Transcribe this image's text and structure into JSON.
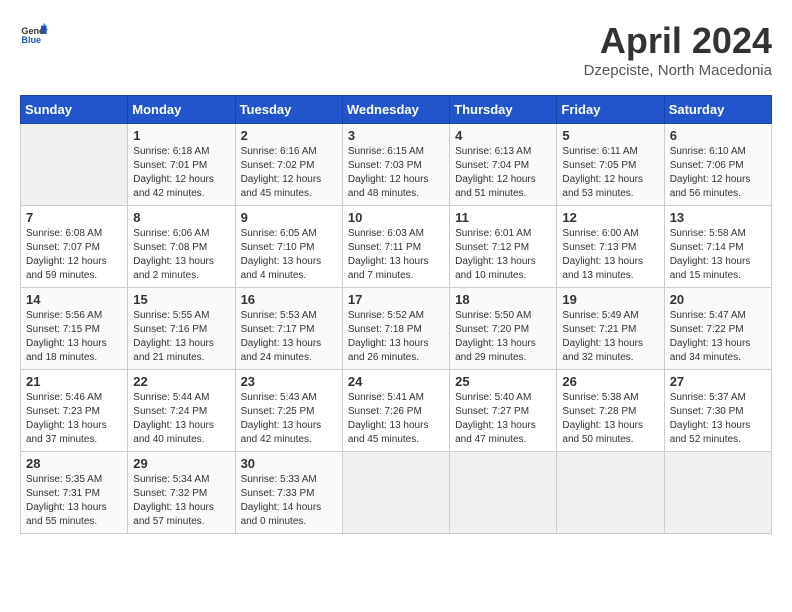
{
  "logo": {
    "line1": "General",
    "line2": "Blue"
  },
  "title": "April 2024",
  "subtitle": "Dzepciste, North Macedonia",
  "days_of_week": [
    "Sunday",
    "Monday",
    "Tuesday",
    "Wednesday",
    "Thursday",
    "Friday",
    "Saturday"
  ],
  "weeks": [
    [
      {
        "day": "",
        "info": ""
      },
      {
        "day": "1",
        "info": "Sunrise: 6:18 AM\nSunset: 7:01 PM\nDaylight: 12 hours\nand 42 minutes."
      },
      {
        "day": "2",
        "info": "Sunrise: 6:16 AM\nSunset: 7:02 PM\nDaylight: 12 hours\nand 45 minutes."
      },
      {
        "day": "3",
        "info": "Sunrise: 6:15 AM\nSunset: 7:03 PM\nDaylight: 12 hours\nand 48 minutes."
      },
      {
        "day": "4",
        "info": "Sunrise: 6:13 AM\nSunset: 7:04 PM\nDaylight: 12 hours\nand 51 minutes."
      },
      {
        "day": "5",
        "info": "Sunrise: 6:11 AM\nSunset: 7:05 PM\nDaylight: 12 hours\nand 53 minutes."
      },
      {
        "day": "6",
        "info": "Sunrise: 6:10 AM\nSunset: 7:06 PM\nDaylight: 12 hours\nand 56 minutes."
      }
    ],
    [
      {
        "day": "7",
        "info": "Sunrise: 6:08 AM\nSunset: 7:07 PM\nDaylight: 12 hours\nand 59 minutes."
      },
      {
        "day": "8",
        "info": "Sunrise: 6:06 AM\nSunset: 7:08 PM\nDaylight: 13 hours\nand 2 minutes."
      },
      {
        "day": "9",
        "info": "Sunrise: 6:05 AM\nSunset: 7:10 PM\nDaylight: 13 hours\nand 4 minutes."
      },
      {
        "day": "10",
        "info": "Sunrise: 6:03 AM\nSunset: 7:11 PM\nDaylight: 13 hours\nand 7 minutes."
      },
      {
        "day": "11",
        "info": "Sunrise: 6:01 AM\nSunset: 7:12 PM\nDaylight: 13 hours\nand 10 minutes."
      },
      {
        "day": "12",
        "info": "Sunrise: 6:00 AM\nSunset: 7:13 PM\nDaylight: 13 hours\nand 13 minutes."
      },
      {
        "day": "13",
        "info": "Sunrise: 5:58 AM\nSunset: 7:14 PM\nDaylight: 13 hours\nand 15 minutes."
      }
    ],
    [
      {
        "day": "14",
        "info": "Sunrise: 5:56 AM\nSunset: 7:15 PM\nDaylight: 13 hours\nand 18 minutes."
      },
      {
        "day": "15",
        "info": "Sunrise: 5:55 AM\nSunset: 7:16 PM\nDaylight: 13 hours\nand 21 minutes."
      },
      {
        "day": "16",
        "info": "Sunrise: 5:53 AM\nSunset: 7:17 PM\nDaylight: 13 hours\nand 24 minutes."
      },
      {
        "day": "17",
        "info": "Sunrise: 5:52 AM\nSunset: 7:18 PM\nDaylight: 13 hours\nand 26 minutes."
      },
      {
        "day": "18",
        "info": "Sunrise: 5:50 AM\nSunset: 7:20 PM\nDaylight: 13 hours\nand 29 minutes."
      },
      {
        "day": "19",
        "info": "Sunrise: 5:49 AM\nSunset: 7:21 PM\nDaylight: 13 hours\nand 32 minutes."
      },
      {
        "day": "20",
        "info": "Sunrise: 5:47 AM\nSunset: 7:22 PM\nDaylight: 13 hours\nand 34 minutes."
      }
    ],
    [
      {
        "day": "21",
        "info": "Sunrise: 5:46 AM\nSunset: 7:23 PM\nDaylight: 13 hours\nand 37 minutes."
      },
      {
        "day": "22",
        "info": "Sunrise: 5:44 AM\nSunset: 7:24 PM\nDaylight: 13 hours\nand 40 minutes."
      },
      {
        "day": "23",
        "info": "Sunrise: 5:43 AM\nSunset: 7:25 PM\nDaylight: 13 hours\nand 42 minutes."
      },
      {
        "day": "24",
        "info": "Sunrise: 5:41 AM\nSunset: 7:26 PM\nDaylight: 13 hours\nand 45 minutes."
      },
      {
        "day": "25",
        "info": "Sunrise: 5:40 AM\nSunset: 7:27 PM\nDaylight: 13 hours\nand 47 minutes."
      },
      {
        "day": "26",
        "info": "Sunrise: 5:38 AM\nSunset: 7:28 PM\nDaylight: 13 hours\nand 50 minutes."
      },
      {
        "day": "27",
        "info": "Sunrise: 5:37 AM\nSunset: 7:30 PM\nDaylight: 13 hours\nand 52 minutes."
      }
    ],
    [
      {
        "day": "28",
        "info": "Sunrise: 5:35 AM\nSunset: 7:31 PM\nDaylight: 13 hours\nand 55 minutes."
      },
      {
        "day": "29",
        "info": "Sunrise: 5:34 AM\nSunset: 7:32 PM\nDaylight: 13 hours\nand 57 minutes."
      },
      {
        "day": "30",
        "info": "Sunrise: 5:33 AM\nSunset: 7:33 PM\nDaylight: 14 hours\nand 0 minutes."
      },
      {
        "day": "",
        "info": ""
      },
      {
        "day": "",
        "info": ""
      },
      {
        "day": "",
        "info": ""
      },
      {
        "day": "",
        "info": ""
      }
    ]
  ]
}
